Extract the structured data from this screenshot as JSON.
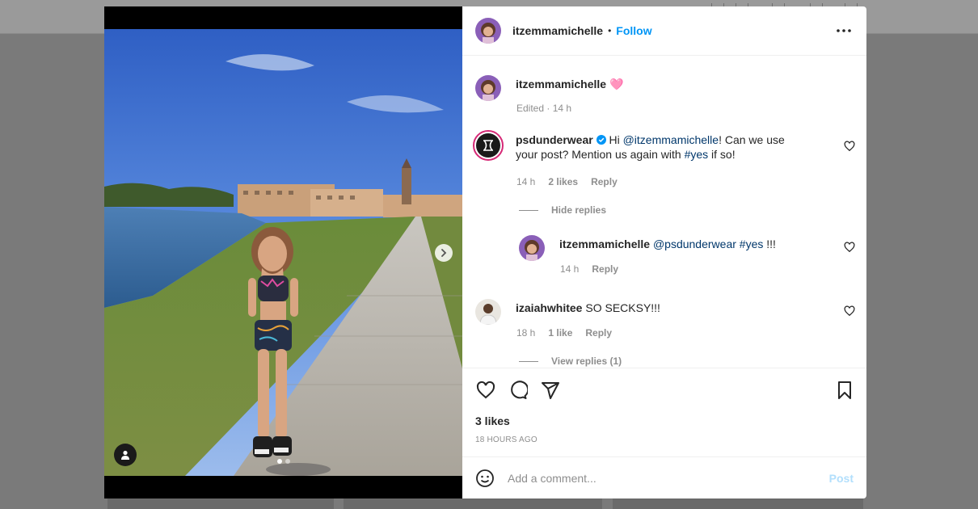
{
  "post": {
    "author": "itzemmamichelle",
    "follow_label": "Follow",
    "separator": "•",
    "caption_author": "itzemmamichelle",
    "caption_emoji": "🩷",
    "caption_meta": "Edited · 14 h",
    "likes": "3 likes",
    "time_ago": "18 HOURS AGO"
  },
  "comments": [
    {
      "username": "psdunderwear",
      "verified": true,
      "text_prefix": " Hi ",
      "mention": "@itzemmamichelle",
      "text_middle": "! Can we use your post? Mention us again with ",
      "hashtag": "#yes",
      "text_suffix": " if so!",
      "time": "14 h",
      "likes": "2 likes",
      "reply_label": "Reply",
      "replies_toggle": "Hide replies"
    },
    {
      "username": "itzemmamichelle",
      "mention": "@psdunderwear",
      "hashtag": "#yes",
      "text_suffix": " !!!",
      "time": "14 h",
      "reply_label": "Reply"
    },
    {
      "username": "izaiahwhitee",
      "text": " SO SECKSY!!!",
      "time": "18 h",
      "likes": "1 like",
      "reply_label": "Reply",
      "replies_toggle": "View replies (1)"
    }
  ],
  "comment_box": {
    "placeholder": "Add a comment...",
    "post_label": "Post"
  },
  "carousel": {
    "total": 2,
    "current": 1
  },
  "colors": {
    "accent": "#0095f6",
    "post_disabled": "#b2dffc",
    "muted": "#8e8e8e",
    "link": "#00376b"
  }
}
